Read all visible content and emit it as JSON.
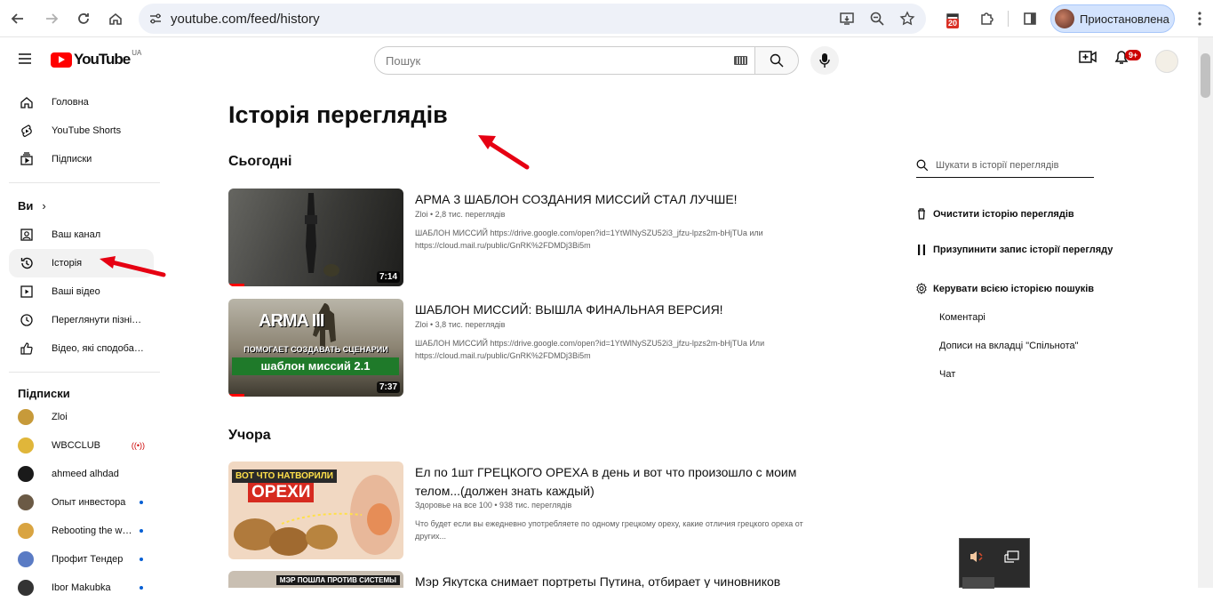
{
  "browser": {
    "url": "youtube.com/feed/history",
    "extension_badge": "20",
    "profile_label": "Приостановлена"
  },
  "masthead": {
    "logo_text": "YouTube",
    "country_code": "UA",
    "search_placeholder": "Пошук",
    "notification_count": "9+"
  },
  "sidebar": {
    "main": [
      {
        "label": "Головна",
        "icon": "home-icon"
      },
      {
        "label": "YouTube Shorts",
        "icon": "shorts-icon"
      },
      {
        "label": "Підписки",
        "icon": "subscriptions-icon"
      }
    ],
    "you_header": "Ви",
    "you": [
      {
        "label": "Ваш канал",
        "icon": "channel-icon"
      },
      {
        "label": "Історія",
        "icon": "history-icon",
        "active": true
      },
      {
        "label": "Ваші відео",
        "icon": "your-videos-icon"
      },
      {
        "label": "Переглянути пізні…",
        "icon": "watch-later-icon"
      },
      {
        "label": "Відео, які сподоба…",
        "icon": "liked-icon"
      }
    ],
    "subs_header": "Підписки",
    "subscriptions": [
      {
        "label": "Zloi",
        "color": "#c79a3a"
      },
      {
        "label": "WBCCLUB",
        "color": "#e0b63a",
        "live": true
      },
      {
        "label": "ahmeed alhdad",
        "color": "#1a1a1a"
      },
      {
        "label": "Опыт инвестора",
        "color": "#6b5a45",
        "new": true
      },
      {
        "label": "Rebooting the w…",
        "color": "#d9a441",
        "new": true
      },
      {
        "label": "Профит Тендер",
        "color": "#5a7bc4",
        "new": true
      },
      {
        "label": "Ibor Makubka",
        "color": "#333333",
        "new": true
      }
    ]
  },
  "main": {
    "title": "Історія переглядів",
    "today_label": "Сьогодні",
    "yesterday_label": "Учора",
    "videos": [
      {
        "title": "АРМА 3 ШАБЛОН СОЗДАНИЯ МИССИЙ СТАЛ ЛУЧШЕ!",
        "channel": "Zloi",
        "views": "2,8 тис. переглядів",
        "desc": "ШАБЛОН МИССИЙ https://drive.google.com/open?id=1YtWlNySZU52i3_jfzu-lpzs2m-bHjTUa или https://cloud.mail.ru/public/GnRK%2FDMDj3Bi5m",
        "duration": "7:14",
        "progress": 0.09
      },
      {
        "title": "ШАБЛОН МИССИЙ: ВЫШЛА ФИНАЛЬНАЯ ВЕРСИЯ!",
        "channel": "Zloi",
        "views": "3,8 тис. переглядів",
        "desc": "ШАБЛОН МИССИЙ https://drive.google.com/open?id=1YtWlNySZU52i3_jfzu-lpzs2m-bHjTUa Или https://cloud.mail.ru/public/GnRK%2FDMDj3Bi5m",
        "duration": "7:37",
        "progress": 0.09,
        "thumb_text_top": "ARMA III",
        "thumb_text_mid": "ПОМОГАЕТ СОЗДАВАТЬ СЦЕНАРИИ",
        "thumb_text_bottom": "шаблон миссий 2.1"
      },
      {
        "title": "Ел по 1шт ГРЕЦКОГО ОРЕХА в день и вот что произошло с моим телом...(должен знать каждый)",
        "channel": "Здоровье на все 100",
        "views": "938 тис. переглядів",
        "desc": "Что будет если вы ежедневно употребляете по одному грецкому ореху, какие отличия грецкого ореха от других...",
        "thumb_text_top": "ВОТ ЧТО НАТВОРИЛИ",
        "thumb_text_mid": "ОРЕХИ"
      },
      {
        "title": "Мэр Якутска снимает портреты Путина, отбирает у чиновников",
        "thumb_text_top": "МЭР ПОШЛА ПРОТИВ СИСТЕМЫ"
      }
    ]
  },
  "right_panel": {
    "search_placeholder": "Шукати в історії переглядів",
    "clear": "Очистити історію переглядів",
    "pause": "Призупинити запис історії перегляду",
    "manage": "Керувати всією історією пошуків",
    "comments": "Коментарі",
    "community": "Дописи на вкладці \"Спільнота\"",
    "chat": "Чат"
  },
  "colors": {
    "brand_red": "#ff0000",
    "annotation_arrow": "#e60012"
  }
}
